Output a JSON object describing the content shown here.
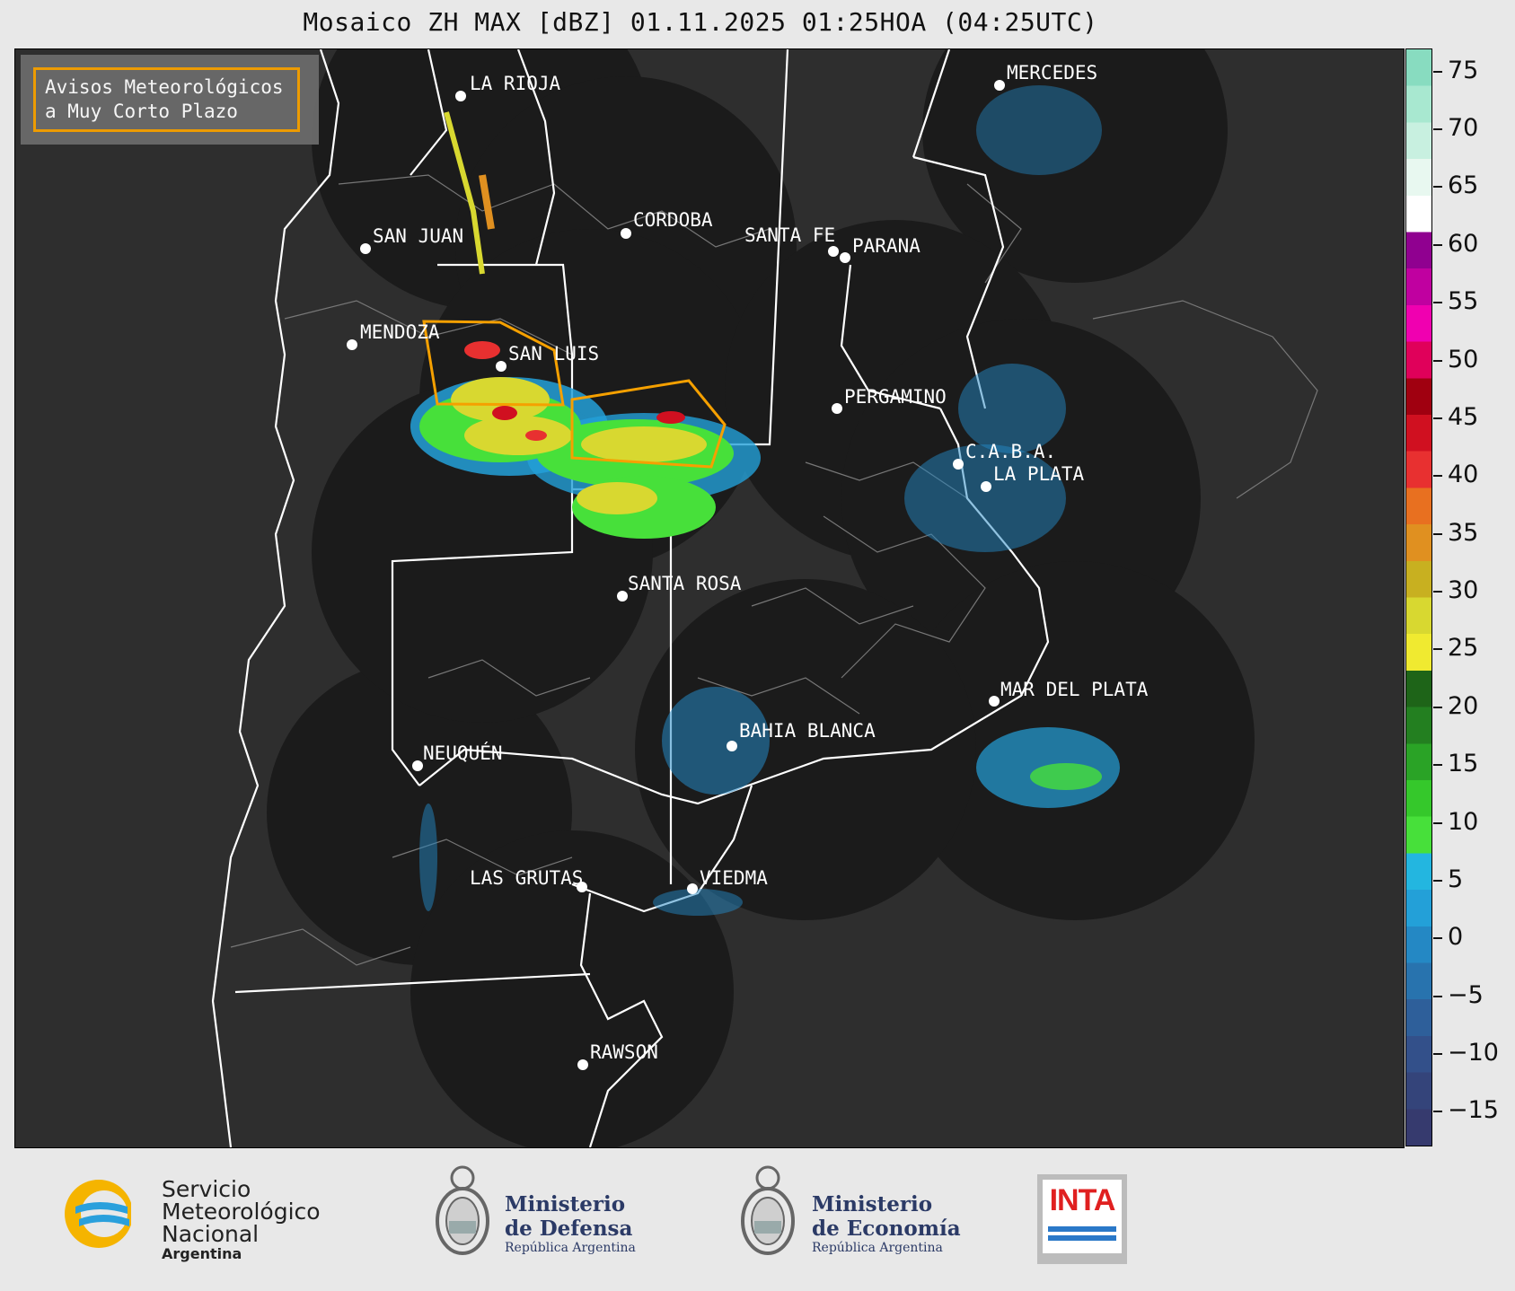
{
  "title": "Mosaico ZH MAX [dBZ] 01.11.2025 01:25HOA (04:25UTC)",
  "alert_legend": {
    "line1": "Avisos Meteorológicos",
    "line2": "a Muy Corto Plazo",
    "outline_color": "#f5a000"
  },
  "cities": [
    {
      "name": "LA RIOJA"
    },
    {
      "name": "MERCEDES"
    },
    {
      "name": "SAN JUAN"
    },
    {
      "name": "CORDOBA"
    },
    {
      "name": "SANTA FE"
    },
    {
      "name": "PARANA"
    },
    {
      "name": "MENDOZA"
    },
    {
      "name": "SAN LUIS"
    },
    {
      "name": "PERGAMINO"
    },
    {
      "name": "C.A.B.A."
    },
    {
      "name": "LA PLATA"
    },
    {
      "name": "SANTA ROSA"
    },
    {
      "name": "MAR DEL PLATA"
    },
    {
      "name": "BAHIA BLANCA"
    },
    {
      "name": "NEUQUÉN"
    },
    {
      "name": "LAS GRUTAS"
    },
    {
      "name": "VIEDMA"
    },
    {
      "name": "RAWSON"
    }
  ],
  "colorbar": {
    "ticks": [
      "75",
      "70",
      "65",
      "60",
      "55",
      "50",
      "45",
      "40",
      "35",
      "30",
      "25",
      "20",
      "15",
      "10",
      "5",
      "0",
      "−5",
      "−10",
      "−15"
    ],
    "scale_min": -18,
    "scale_max": 77,
    "colors": [
      "#363a6e",
      "#34447a",
      "#33508a",
      "#2e5f9a",
      "#2873ae",
      "#2488c4",
      "#23a0d8",
      "#23b6e0",
      "#47e03a",
      "#35c82b",
      "#2aa326",
      "#237f20",
      "#1e6418",
      "#f0ea30",
      "#d8d830",
      "#c8b020",
      "#e09020",
      "#e87020",
      "#e83030",
      "#d01020",
      "#a00010",
      "#e0005a",
      "#f000b0",
      "#c000a0",
      "#900090",
      "#ffffff",
      "#e8f8f0",
      "#c8f0e0",
      "#a8e8d0",
      "#88dcc0"
    ]
  },
  "logos": {
    "smn": {
      "line1": "Servicio",
      "line2": "Meteorológico",
      "line3": "Nacional",
      "line4": "Argentina"
    },
    "defensa": {
      "line1": "Ministerio",
      "line2": "de Defensa",
      "line3": "República Argentina"
    },
    "economia": {
      "line1": "Ministerio",
      "line2": "de Economía",
      "line3": "República Argentina"
    },
    "inta": {
      "text": "INTA"
    }
  }
}
